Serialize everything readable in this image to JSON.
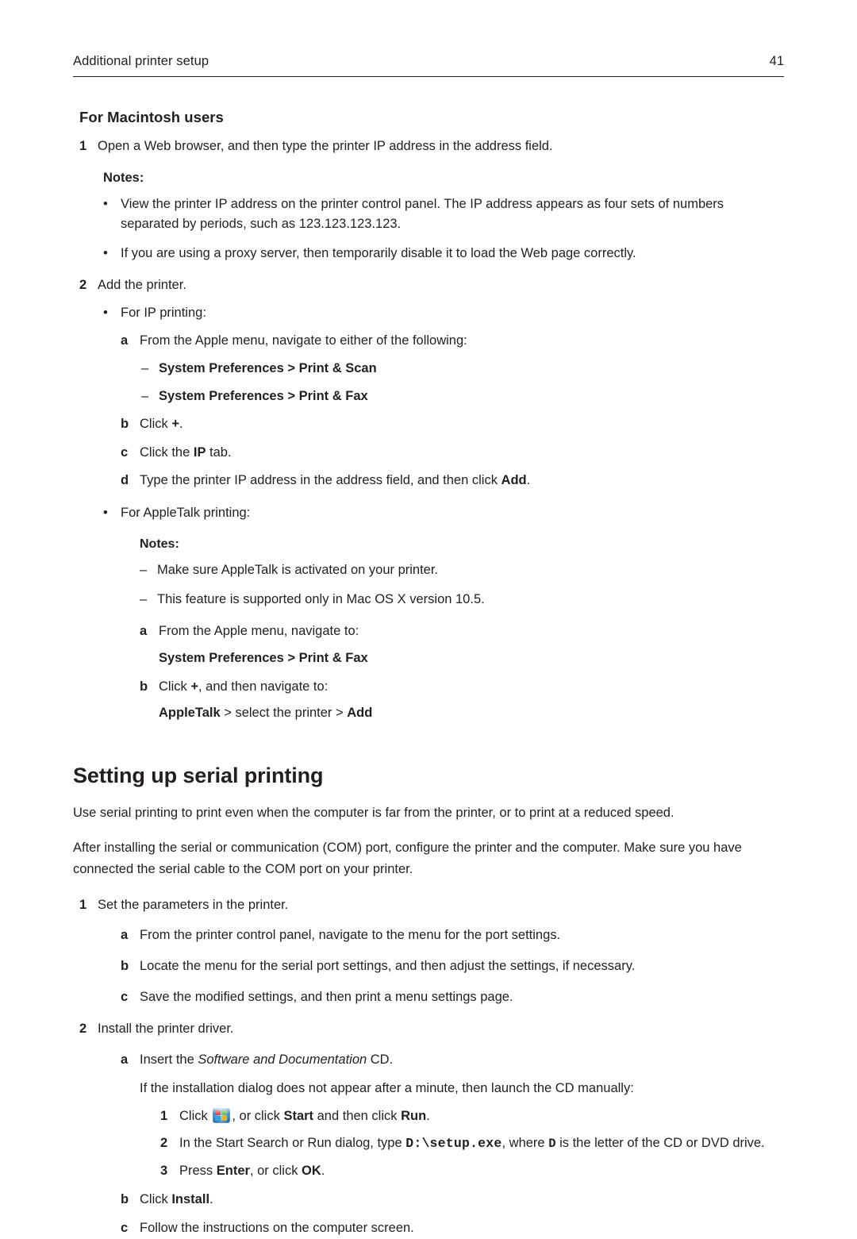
{
  "header": {
    "left": "Additional printer setup",
    "page_number": "41"
  },
  "mac_section": {
    "heading": "For Macintosh users",
    "step1": {
      "num": "1",
      "text": "Open a Web browser, and then type the printer IP address in the address field."
    },
    "notes_label": "Notes:",
    "note1": "View the printer IP address on the printer control panel. The IP address appears as four sets of numbers separated by periods, such as 123.123.123.123.",
    "note2": "If you are using a proxy server, then temporarily disable it to load the Web page correctly.",
    "step2": {
      "num": "2",
      "text": "Add the printer."
    },
    "ip_printing_label": "For IP printing:",
    "ip_a": {
      "marker": "a",
      "text": "From the Apple menu, navigate to either of the following:"
    },
    "ip_dash1": "System Preferences > Print & Scan",
    "ip_dash2": "System Preferences > Print & Fax",
    "ip_b_marker": "b",
    "ip_b_pre": "Click ",
    "ip_b_bold": "+",
    "ip_b_post": ".",
    "ip_c_marker": "c",
    "ip_c_pre": "Click the ",
    "ip_c_bold": "IP",
    "ip_c_post": " tab.",
    "ip_d_marker": "d",
    "ip_d_pre": "Type the printer IP address in the address field, and then click ",
    "ip_d_bold": "Add",
    "ip_d_post": ".",
    "appletalk_label": "For AppleTalk printing:",
    "at_notes_label": "Notes:",
    "at_note1": "Make sure AppleTalk is activated on your printer.",
    "at_note2": "This feature is supported only in Mac OS X version 10.5.",
    "at_a_marker": "a",
    "at_a_text": "From the Apple menu, navigate to:",
    "at_a_sub": "System Preferences > Print & Fax",
    "at_b_marker": "b",
    "at_b_pre": "Click ",
    "at_b_bold": "+",
    "at_b_post": ", and then navigate to:",
    "at_b_sub_bold1": "AppleTalk",
    "at_b_sub_mid": " > select the printer > ",
    "at_b_sub_bold2": "Add"
  },
  "serial_section": {
    "heading": "Setting up serial printing",
    "para1": "Use serial printing to print even when the computer is far from the printer, or to print at a reduced speed.",
    "para2": "After installing the serial or communication (COM) port, configure the printer and the computer. Make sure you have connected the serial cable to the COM port on your printer.",
    "step1": {
      "num": "1",
      "text": "Set the parameters in the printer."
    },
    "s1a": {
      "marker": "a",
      "text": "From the printer control panel, navigate to the menu for the port settings."
    },
    "s1b": {
      "marker": "b",
      "text": "Locate the menu for the serial port settings, and then adjust the settings, if necessary."
    },
    "s1c": {
      "marker": "c",
      "text": "Save the modified settings, and then print a menu settings page."
    },
    "step2": {
      "num": "2",
      "text": "Install the printer driver."
    },
    "s2a_marker": "a",
    "s2a_pre": "Insert the ",
    "s2a_italic": "Software and Documentation",
    "s2a_post": " CD.",
    "s2a_note": "If the installation dialog does not appear after a minute, then launch the CD manually:",
    "n1_marker": "1",
    "n1_pre": "Click ",
    "n1_icon": "windows-start-icon",
    "n1_mid": ", or click ",
    "n1_bold1": "Start",
    "n1_mid2": " and then click ",
    "n1_bold2": "Run",
    "n1_post": ".",
    "n2_marker": "2",
    "n2_pre": "In the Start Search or Run dialog, type ",
    "n2_mono1": "D:\\setup.exe",
    "n2_mid": ", where ",
    "n2_mono2": "D",
    "n2_post": " is the letter of the CD or DVD drive.",
    "n3_marker": "3",
    "n3_pre": "Press ",
    "n3_bold1": "Enter",
    "n3_mid": ", or click ",
    "n3_bold2": "OK",
    "n3_post": ".",
    "s2b_marker": "b",
    "s2b_pre": "Click ",
    "s2b_bold": "Install",
    "s2b_post": ".",
    "s2c_marker": "c",
    "s2c_text": "Follow the instructions on the computer screen."
  }
}
